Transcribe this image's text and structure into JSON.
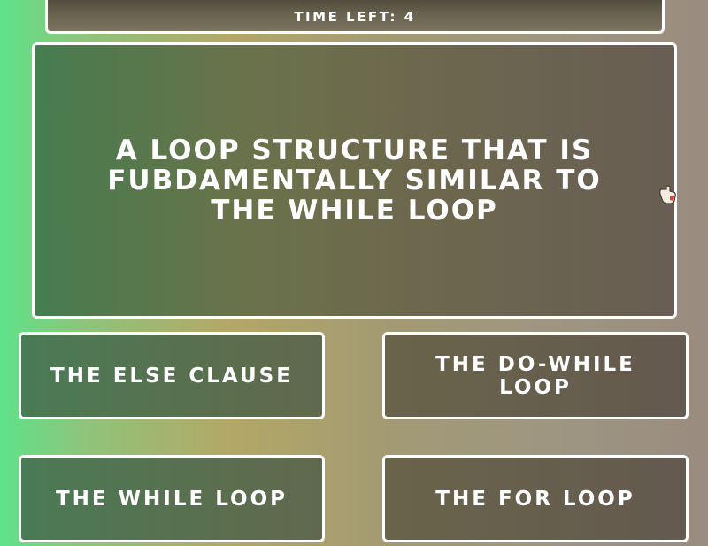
{
  "timer": {
    "label": "Time left: 4"
  },
  "question": {
    "text": "A loop structure that is fubdamentally similar to the while loop"
  },
  "answers": [
    {
      "label": "The else clause"
    },
    {
      "label": "The do-while loop"
    },
    {
      "label": "The while loop"
    },
    {
      "label": "The for loop"
    }
  ],
  "colors": {
    "background_left": "#5fe28a",
    "background_mid": "#b3a866",
    "background_right": "#9a8c80",
    "panel_border": "#ffffff",
    "text": "#ffffff"
  },
  "icons": {
    "cursor": "hand-pointer-cursor-icon"
  }
}
